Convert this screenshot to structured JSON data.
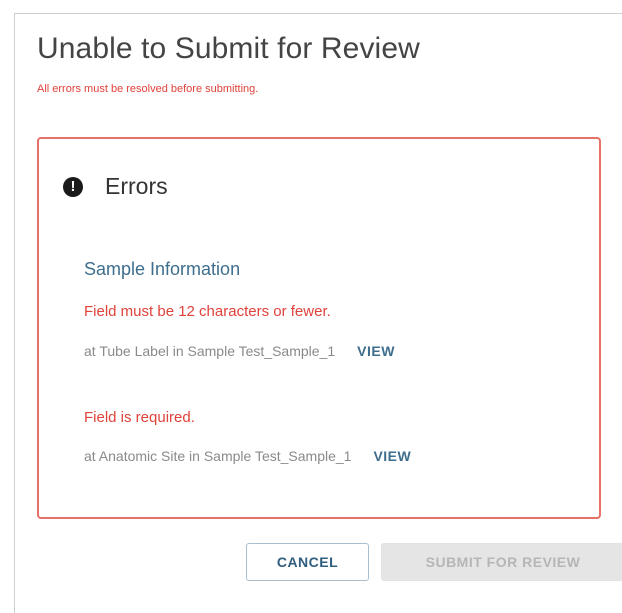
{
  "dialog": {
    "title": "Unable to Submit for Review",
    "subtitle": "All errors must be resolved before submitting."
  },
  "errors_panel": {
    "icon": "exclamation-circle-icon",
    "alert_glyph": "!",
    "heading": "Errors",
    "section_title": "Sample Information",
    "items": [
      {
        "message": "Field must be 12 characters or fewer.",
        "location": "at Tube Label in Sample Test_Sample_1",
        "action": "VIEW"
      },
      {
        "message": "Field is required.",
        "location": "at Anatomic Site in Sample Test_Sample_1",
        "action": "VIEW"
      }
    ]
  },
  "footer": {
    "cancel_label": "CANCEL",
    "submit_label": "SUBMIT FOR REVIEW",
    "submit_disabled": true
  },
  "colors": {
    "error_red": "#e0423a",
    "border_red": "#e8706a",
    "link_blue": "#3e6e8e"
  }
}
